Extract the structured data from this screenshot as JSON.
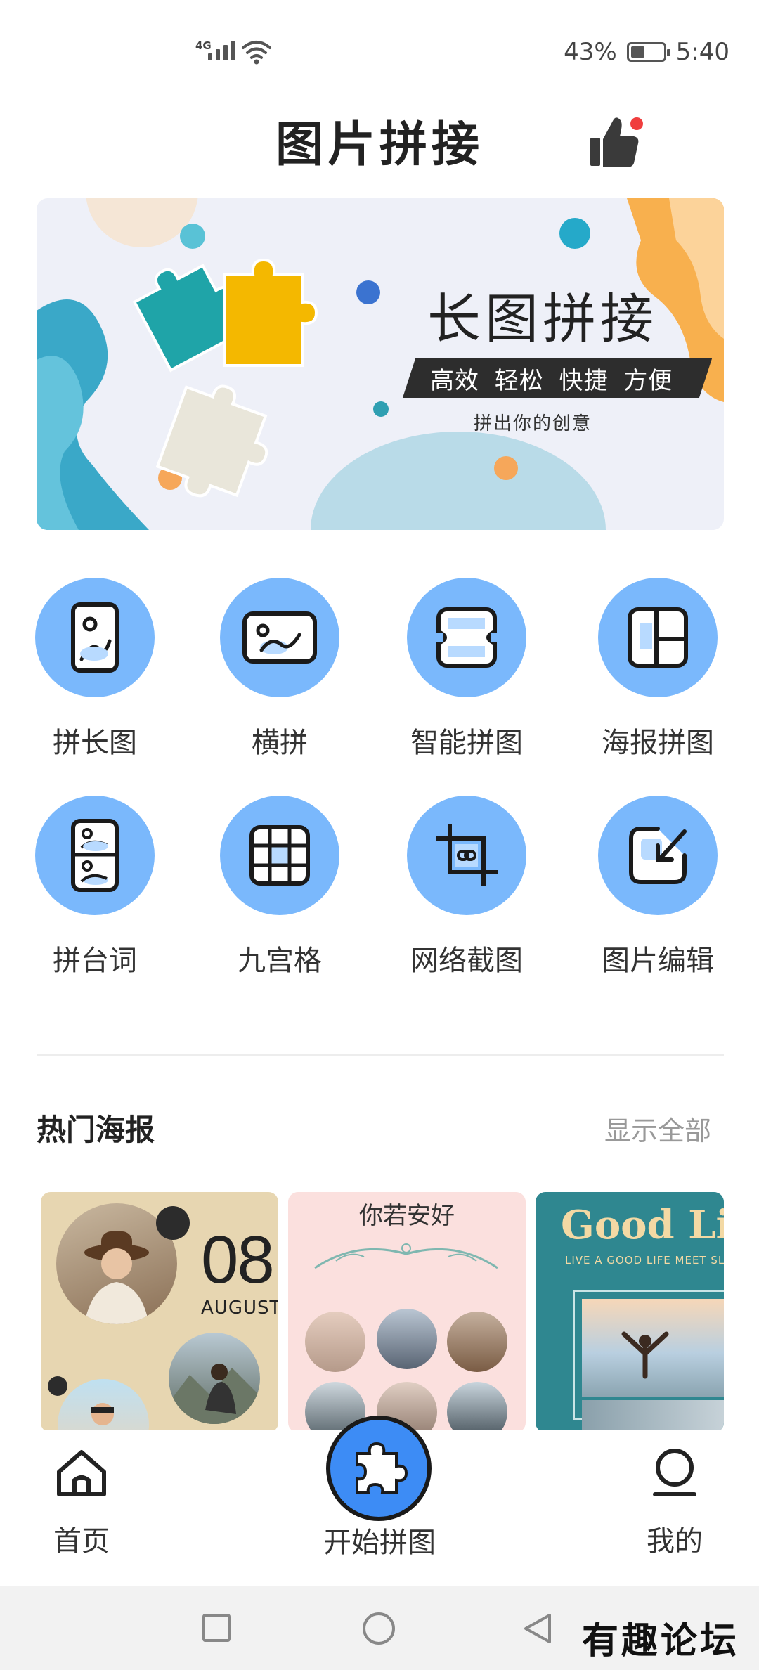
{
  "status_bar": {
    "network": "4G",
    "battery_percent": "43%",
    "battery_level": 0.43,
    "time": "5:40"
  },
  "header": {
    "title": "图片拼接",
    "like_icon": "thumbs-up-icon",
    "notification_dot_color": "#f03e3e"
  },
  "banner": {
    "title": "长图拼接",
    "tags": "高效 轻松 快捷 方便",
    "subtitle": "拼出你的创意"
  },
  "functions": [
    {
      "label": "拼长图",
      "icon": "long-image-icon"
    },
    {
      "label": "横拼",
      "icon": "horizontal-image-icon"
    },
    {
      "label": "智能拼图",
      "icon": "smart-stitch-icon"
    },
    {
      "label": "海报拼图",
      "icon": "poster-layout-icon"
    },
    {
      "label": "拼台词",
      "icon": "subtitle-stitch-icon"
    },
    {
      "label": "九宫格",
      "icon": "nine-grid-icon"
    },
    {
      "label": "网络截图",
      "icon": "web-screenshot-icon"
    },
    {
      "label": "图片编辑",
      "icon": "image-edit-icon"
    }
  ],
  "hot_posters": {
    "title": "热门海报",
    "show_all": "显示全部",
    "cards": [
      {
        "day": "08",
        "month": "AUGUST"
      },
      {
        "title": "你若安好"
      },
      {
        "title": "Good Life",
        "subtitle": "LIVE A GOOD LIFE MEET SLOW"
      }
    ]
  },
  "tabbar": {
    "home": "首页",
    "start": "开始拼图",
    "mine": "我的"
  },
  "watermark": "有趣论坛",
  "colors": {
    "accent": "#3d8cf5",
    "icon_circle": "#7ab8fc"
  }
}
